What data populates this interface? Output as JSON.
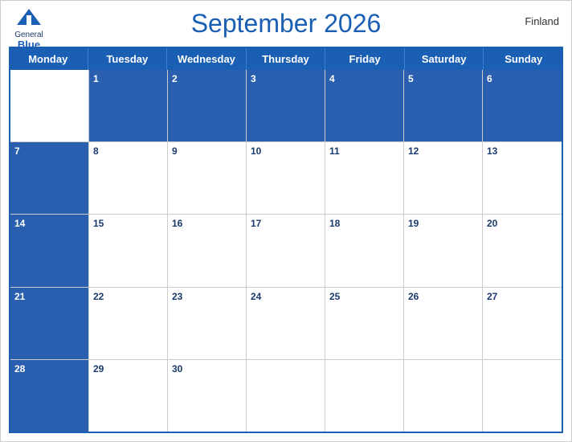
{
  "header": {
    "title": "September 2026",
    "country": "Finland",
    "logo": {
      "general": "General",
      "blue": "Blue"
    }
  },
  "days": [
    "Monday",
    "Tuesday",
    "Wednesday",
    "Thursday",
    "Friday",
    "Saturday",
    "Sunday"
  ],
  "weeks": [
    [
      null,
      1,
      2,
      3,
      4,
      5,
      6
    ],
    [
      7,
      8,
      9,
      10,
      11,
      12,
      13
    ],
    [
      14,
      15,
      16,
      17,
      18,
      19,
      20
    ],
    [
      21,
      22,
      23,
      24,
      25,
      26,
      27
    ],
    [
      28,
      29,
      30,
      null,
      null,
      null,
      null
    ]
  ],
  "colors": {
    "headerBlue": "#1a5fb4",
    "darkBlue": "#1a3a6e",
    "rowBlue": "#2a5faf"
  }
}
